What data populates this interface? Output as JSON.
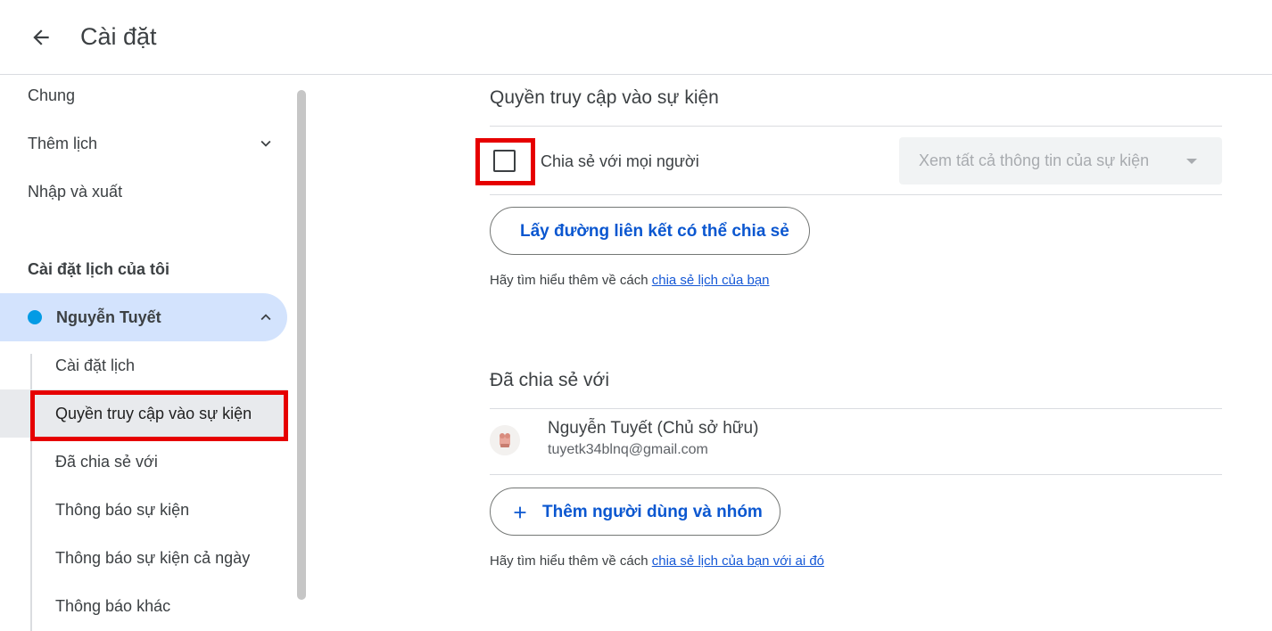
{
  "header": {
    "title": "Cài đặt",
    "back_icon": "arrow-back-icon"
  },
  "sidebar": {
    "items": [
      {
        "label": "Chung"
      },
      {
        "label": "Thêm lịch",
        "icon": "chevron-down-icon"
      },
      {
        "label": "Nhập và xuất"
      }
    ],
    "section_title": "Cài đặt lịch của tôi",
    "calendar": {
      "name": "Nguyễn Tuyết",
      "color": "#039be5",
      "icon": "chevron-up-icon"
    },
    "sub_items": [
      {
        "label": "Cài đặt lịch"
      },
      {
        "label": "Quyền truy cập vào sự kiện"
      },
      {
        "label": "Đã chia sẻ với"
      },
      {
        "label": "Thông báo sự kiện"
      },
      {
        "label": "Thông báo sự kiện cả ngày"
      },
      {
        "label": "Thông báo khác"
      }
    ]
  },
  "access": {
    "title": "Quyền truy cập vào sự kiện",
    "share_public_label": "Chia sẻ với mọi người",
    "share_public_checked": false,
    "permission_select": "Xem tất cả thông tin của sự kiện",
    "get_link_button": "Lấy đường liên kết có thể chia sẻ",
    "help_prefix": "Hãy tìm hiểu thêm về cách",
    "help_link": "chia sẻ lịch của bạn"
  },
  "shared_with": {
    "title": "Đã chia sẻ với",
    "users": [
      {
        "name": "Nguyễn Tuyết (Chủ sở hữu)",
        "email": "tuyetk34blnq@gmail.com"
      }
    ],
    "add_button": "Thêm người dùng và nhóm",
    "help_prefix": "Hãy tìm hiểu thêm về cách",
    "help_link": "chia sẻ lịch của bạn với ai đó"
  },
  "colors": {
    "accent": "#0b57d0",
    "highlight_box": "#e60000",
    "selected_calendar_bg": "#d3e3fd"
  }
}
